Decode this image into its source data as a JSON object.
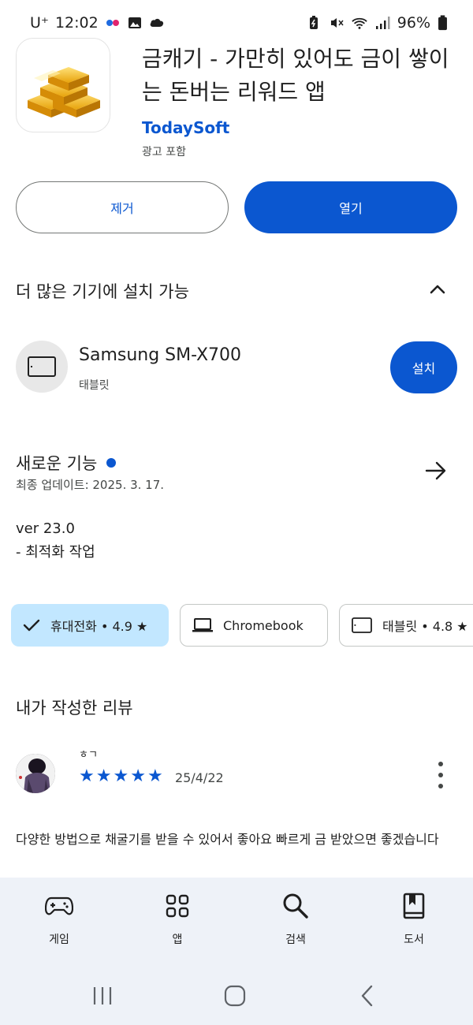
{
  "status_bar": {
    "carrier": "U⁺",
    "time": "12:02",
    "battery": "96%",
    "left_icons": [
      "flickr-dots-icon",
      "gallery-icon",
      "cloud-chat-icon"
    ],
    "right_icons": [
      "battery-saver-icon",
      "mute-icon",
      "wifi-icon",
      "signal-icon",
      "battery-icon"
    ]
  },
  "app": {
    "title": "금캐기 - 가만히 있어도 금이 쌓이는 돈버는 리워드 앱",
    "developer": "TodaySoft",
    "ads_note": "광고 포함",
    "icon": "gold-bars-icon"
  },
  "actions": {
    "remove_label": "제거",
    "open_label": "열기"
  },
  "more_devices": {
    "title": "더 많은 기기에 설치 가능",
    "device_name": "Samsung SM-X700",
    "device_type": "태블릿",
    "install_label": "설치"
  },
  "whats_new": {
    "title": "새로운 기능",
    "updated": "최종 업데이트: 2025. 3. 17.",
    "notes_line1": "ver 23.0",
    "notes_line2": "- 최적화 작업"
  },
  "device_chips": [
    {
      "label": "휴대전화 • 4.9 ★",
      "selected": true
    },
    {
      "label": "Chromebook",
      "selected": false
    },
    {
      "label": "태블릿 • 4.8 ★",
      "selected": false
    }
  ],
  "my_review": {
    "title": "내가 작성한 리뷰",
    "reviewer": "ㅎㄱ",
    "rating": 5,
    "date": "25/4/22",
    "text": "다양한 방법으로 채굴기를 받을 수 있어서 좋아요 빠르게 금 받았으면 좋겠습니다"
  },
  "bottom_nav": {
    "items": [
      {
        "label": "게임",
        "icon": "gamepad-icon"
      },
      {
        "label": "앱",
        "icon": "apps-grid-icon"
      },
      {
        "label": "검색",
        "icon": "search-icon"
      },
      {
        "label": "도서",
        "icon": "book-icon"
      }
    ]
  },
  "colors": {
    "accent": "#0b57d0",
    "chip_selected": "#c2e7ff",
    "nav_bg": "#eef2f8"
  }
}
